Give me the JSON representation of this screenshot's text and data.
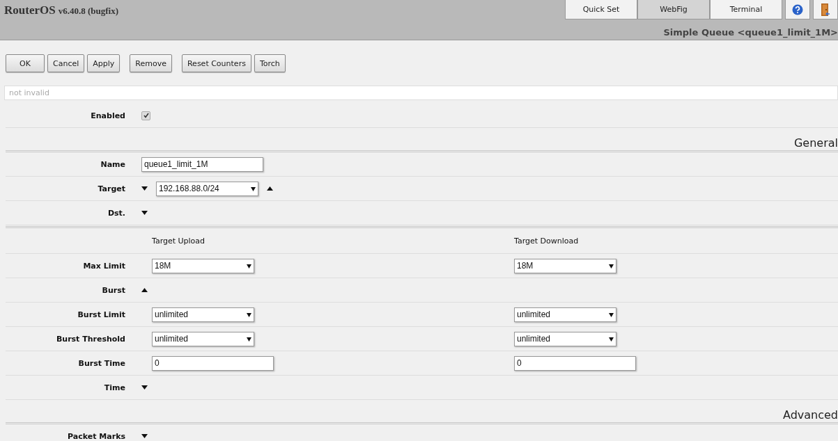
{
  "header": {
    "product": "RouterOS",
    "version": "v6.40.8 (bugfix)",
    "page_title": "Simple Queue <queue1_limit_1M>"
  },
  "nav": [
    {
      "kind": "tab",
      "label": "Quick Set",
      "selected": false
    },
    {
      "kind": "tab",
      "label": "WebFig",
      "selected": true
    },
    {
      "kind": "tab",
      "label": "Terminal",
      "selected": false
    },
    {
      "kind": "help",
      "selected": false
    },
    {
      "kind": "logout",
      "selected": false
    }
  ],
  "actions": [
    [
      "OK",
      "Cancel",
      "Apply"
    ],
    [
      "Remove"
    ],
    [
      "Reset Counters",
      "Torch"
    ]
  ],
  "status": {
    "value": "not invalid"
  },
  "rows": [
    {
      "kind": "checkbox",
      "label": "Enabled",
      "checked": true
    },
    {
      "kind": "section",
      "title": "General"
    },
    {
      "kind": "text",
      "label": "Name",
      "value": "queue1_limit_1M"
    },
    {
      "kind": "select-list",
      "label": "Target",
      "value": "192.168.88.0/24"
    },
    {
      "kind": "expander",
      "label": "Dst.",
      "expanded": false
    },
    {
      "kind": "section"
    },
    {
      "kind": "columns",
      "values": [
        "Target Upload",
        "Target Download"
      ]
    },
    {
      "kind": "pair-select",
      "label": "Max Limit",
      "values": [
        "18M",
        "18M"
      ]
    },
    {
      "kind": "expander",
      "label": "Burst",
      "expanded": true
    },
    {
      "kind": "pair-select",
      "label": "Burst Limit",
      "values": [
        "unlimited",
        "unlimited"
      ]
    },
    {
      "kind": "pair-select",
      "label": "Burst Threshold",
      "values": [
        "unlimited",
        "unlimited"
      ]
    },
    {
      "kind": "pair-text",
      "label": "Burst Time",
      "values": [
        "0",
        "0"
      ]
    },
    {
      "kind": "expander",
      "label": "Time",
      "expanded": false
    },
    {
      "kind": "section",
      "title": "Advanced"
    },
    {
      "kind": "expander",
      "label": "Packet Marks",
      "expanded": false
    }
  ]
}
